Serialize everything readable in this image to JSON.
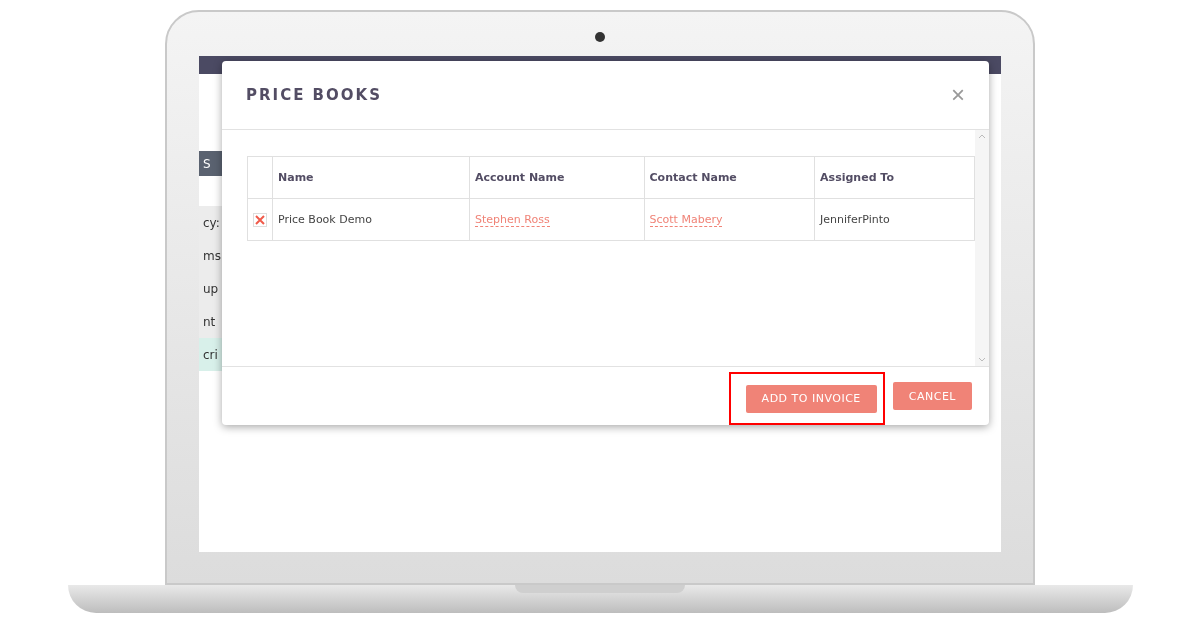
{
  "background_app": {
    "side_labels": [
      {
        "text": "S",
        "kind": "bar"
      },
      {
        "text": "cy:",
        "kind": "label"
      },
      {
        "text": "ms",
        "kind": "label"
      },
      {
        "text": "up",
        "kind": "label"
      },
      {
        "text": "nt",
        "kind": "label"
      },
      {
        "text": "cri",
        "kind": "mint"
      }
    ]
  },
  "dialog": {
    "title": "PRICE BOOKS",
    "close": "×",
    "table": {
      "columns": [
        "Name",
        "Account Name",
        "Contact Name",
        "Assigned To"
      ],
      "rows": [
        {
          "name": "Price Book Demo",
          "account_name": "Stephen Ross",
          "contact_name": "Scott Mabery",
          "assigned_to": "JenniferPinto"
        }
      ]
    },
    "buttons": [
      {
        "label": "ADD TO INVOICE",
        "highlighted": true
      },
      {
        "label": "CANCEL",
        "highlighted": false
      }
    ]
  }
}
